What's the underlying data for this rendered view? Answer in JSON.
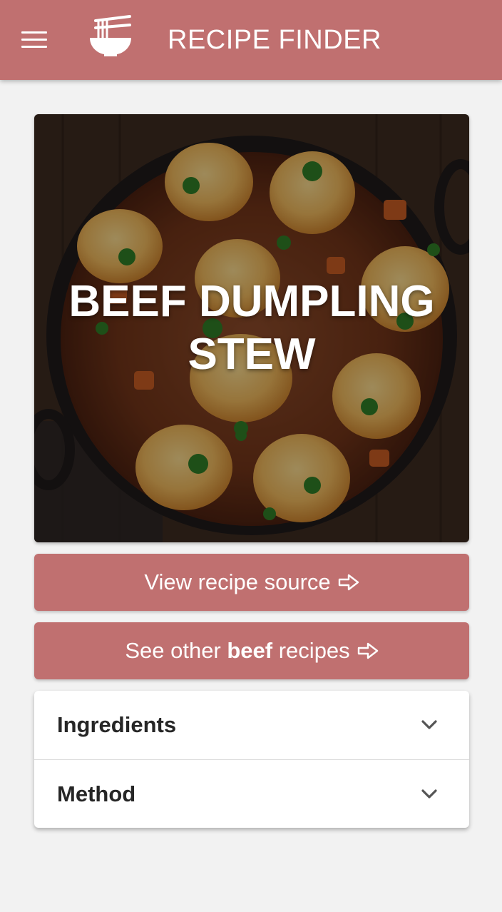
{
  "app": {
    "title": "RECIPE FINDER",
    "accent_color": "#c07070",
    "icons": {
      "menu": "hamburger-menu-icon",
      "logo": "noodle-bowl-icon"
    }
  },
  "recipe": {
    "title": "BEEF DUMPLING STEW",
    "image": "beef-dumpling-stew-photo"
  },
  "buttons": {
    "source": {
      "label": "View recipe source",
      "icon": "arrow-right-outline-icon"
    },
    "other": {
      "prefix": "See other ",
      "keyword": "beef",
      "suffix": " recipes",
      "icon": "arrow-right-outline-icon"
    }
  },
  "sections": [
    {
      "label": "Ingredients",
      "icon": "chevron-down-icon"
    },
    {
      "label": "Method",
      "icon": "chevron-down-icon"
    }
  ]
}
